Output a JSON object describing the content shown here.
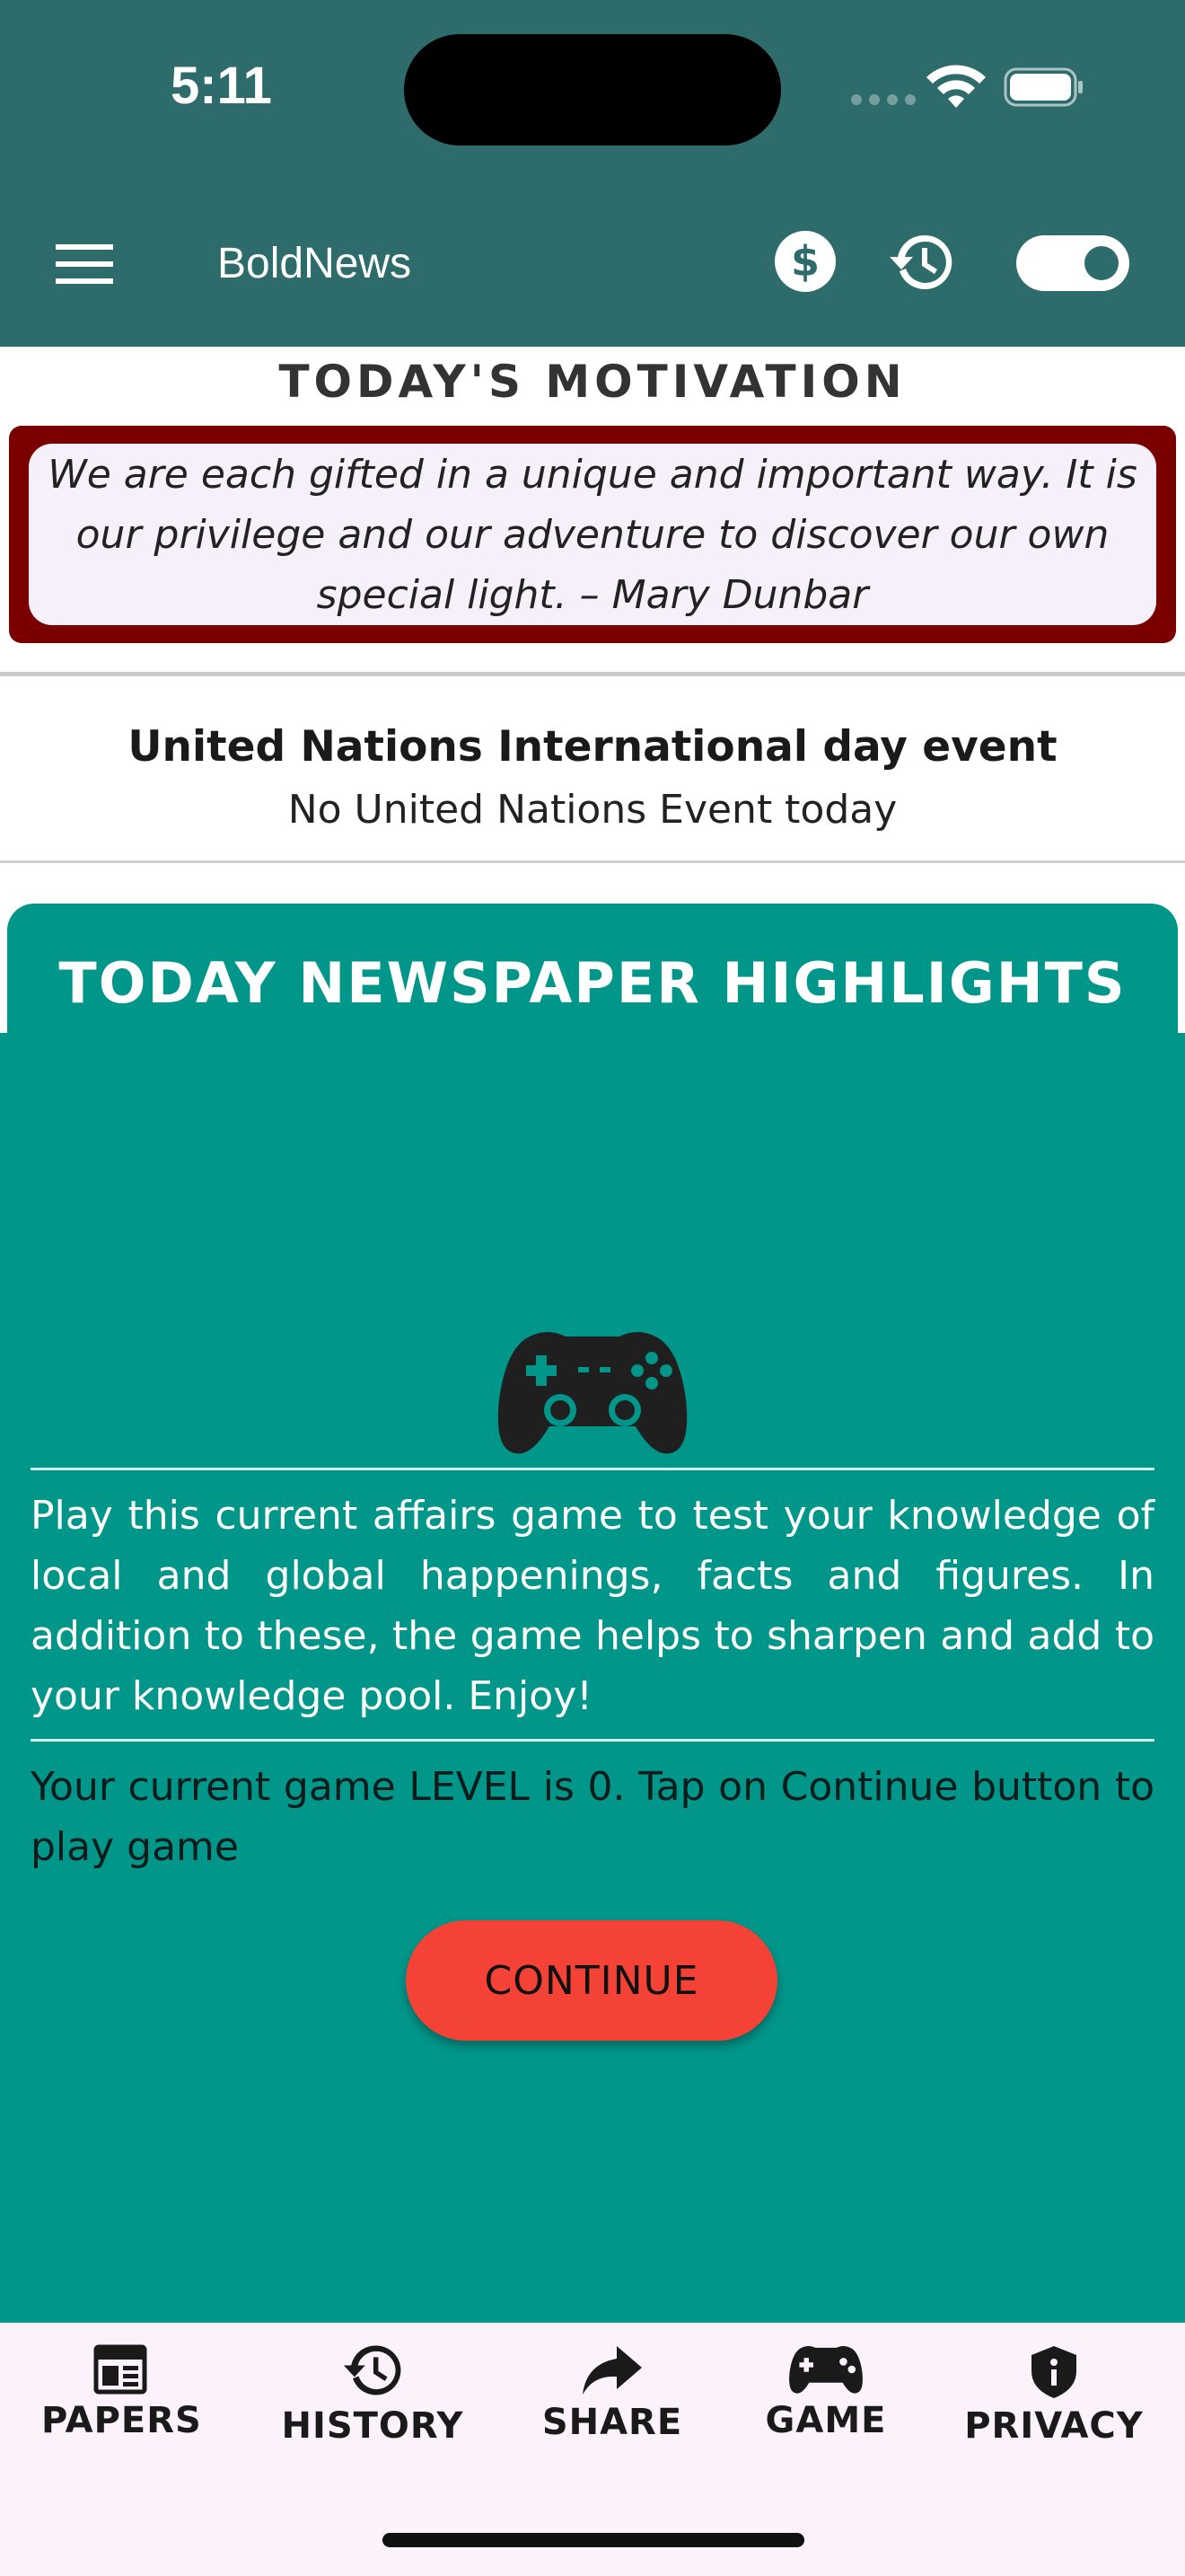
{
  "status_bar": {
    "time": "5:11"
  },
  "app_bar": {
    "title": "BoldNews",
    "icons": [
      "menu-icon",
      "dollar-icon",
      "history-icon",
      "toggle-switch"
    ],
    "color": "#2e6b6b"
  },
  "motivation": {
    "heading": "TODAY'S MOTIVATION",
    "quote": "We are each gifted in a unique and important way. It is our privilege and our adventure to discover our own special light. – Mary Dunbar",
    "frame_color": "#7a0000"
  },
  "un_event": {
    "title": "United Nations International day event",
    "subtitle": "No United Nations Event today"
  },
  "highlights": {
    "heading": "TODAY NEWSPAPER HIGHLIGHTS",
    "panel_color": "#00968a",
    "game_icon": "gamepad-icon",
    "description": "Play this current affairs game to test your knowledge of local and global happenings, facts and figures. In addition to these, the game helps to sharpen and add to your knowledge pool. Enjoy!",
    "level_text": "Your current game LEVEL is 0. Tap on Continue button to play game",
    "continue_label": "CONTINUE",
    "button_color": "#f44336"
  },
  "bottom_nav": {
    "items": [
      {
        "label": "PAPERS",
        "icon": "newspaper-icon"
      },
      {
        "label": "HISTORY",
        "icon": "history-icon"
      },
      {
        "label": "SHARE",
        "icon": "share-icon"
      },
      {
        "label": "GAME",
        "icon": "gamepad-icon"
      },
      {
        "label": "PRIVACY",
        "icon": "shield-icon"
      }
    ]
  }
}
